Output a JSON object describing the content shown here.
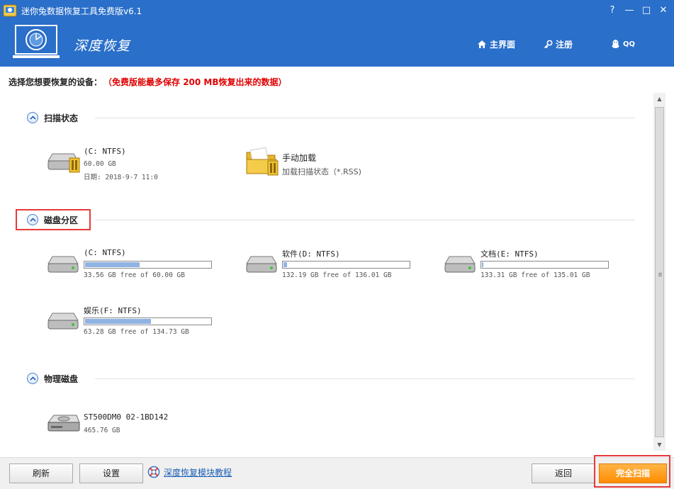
{
  "window": {
    "title": "迷你兔数据恢复工具免费版v6.1",
    "controls": {
      "help": "?",
      "minimize": "—",
      "maximize": "□",
      "close": "✕"
    }
  },
  "header": {
    "brand": "深度恢复",
    "nav": [
      {
        "label": "主界面",
        "icon": "home-icon"
      },
      {
        "label": "注册",
        "icon": "key-icon"
      },
      {
        "label": "QQ",
        "icon": "qq-penguin-icon"
      }
    ]
  },
  "instruction": {
    "label": "选择您想要恢复的设备：",
    "warning": "（免费版能最多保存 200 MB恢复出来的数据）"
  },
  "sections": {
    "scan_status": {
      "title": "扫描状态",
      "items": [
        {
          "name": "(C: NTFS)",
          "size": "60.00 GB",
          "date": "日期: 2018-9-7 11:0",
          "icon": "hard-drive-icon"
        },
        {
          "name": "手动加载",
          "desc": "加载扫描状态（*.RSS)",
          "icon": "folder-icon"
        }
      ]
    },
    "partitions": {
      "title": "磁盘分区",
      "items": [
        {
          "name": "(C: NTFS)",
          "free": "33.56 GB free of 60.00 GB",
          "used_fraction": 0.44
        },
        {
          "name": "软件(D: NTFS)",
          "free": "132.19 GB free of 136.01 GB",
          "used_fraction": 0.03
        },
        {
          "name": "文档(E: NTFS)",
          "free": "133.31 GB free of 135.01 GB",
          "used_fraction": 0.01
        },
        {
          "name": "娱乐(F: NTFS)",
          "free": "63.28 GB free of 134.73 GB",
          "used_fraction": 0.53
        }
      ]
    },
    "physical": {
      "title": "物理磁盘",
      "items": [
        {
          "name": "ST500DM0 02-1BD142",
          "size": "465.76 GB",
          "icon": "physical-disk-icon"
        }
      ]
    }
  },
  "bottom": {
    "refresh": "刷新",
    "settings": "设置",
    "tutorial": "深度恢复模块教程",
    "back": "返回",
    "full_scan": "完全扫描"
  },
  "colors": {
    "header_blue": "#2a6fc9",
    "warning_red": "#e00000",
    "highlight_red": "#e8393b",
    "primary_orange": "#ff8c00",
    "bar_fill": "#8fb3e3",
    "link_blue": "#1a5fb4"
  }
}
